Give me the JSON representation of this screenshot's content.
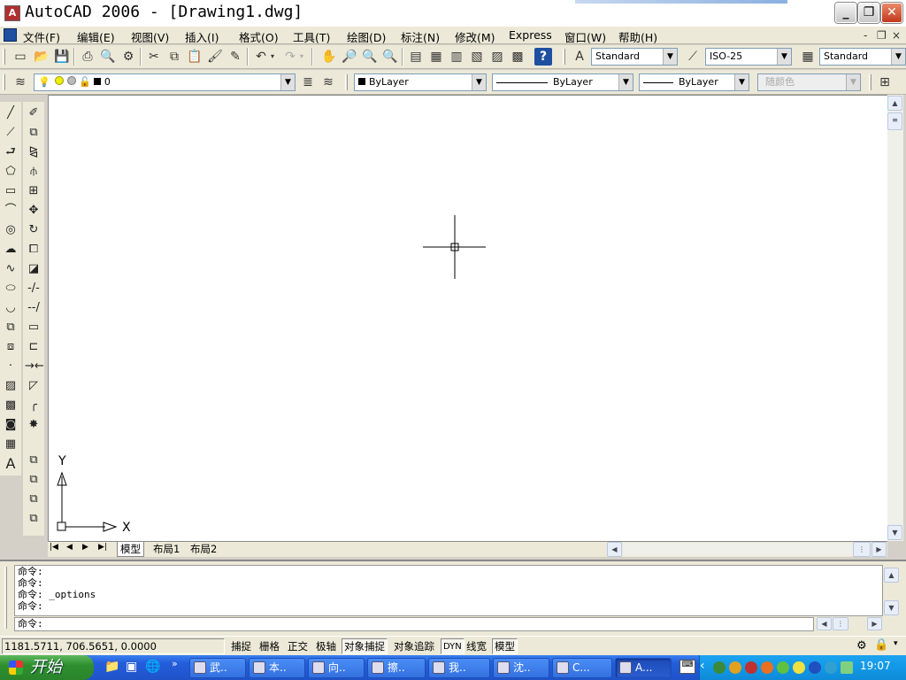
{
  "window": {
    "title": "AutoCAD 2006 - [Drawing1.dwg]",
    "app_icon": "autocad-icon",
    "buttons": [
      "minimize",
      "restore",
      "close"
    ]
  },
  "menu": {
    "items": [
      "文件(F)",
      "编辑(E)",
      "视图(V)",
      "插入(I)",
      "格式(O)",
      "工具(T)",
      "绘图(D)",
      "标注(N)",
      "修改(M)",
      "Express",
      "窗口(W)",
      "帮助(H)"
    ],
    "mdi_buttons": [
      "-",
      "❐",
      "×"
    ]
  },
  "standard_toolbar": {
    "text_style": "Standard",
    "dim_style": "ISO-25",
    "table_style": "Standard"
  },
  "layers_toolbar": {
    "current_layer": "0",
    "color": "ByLayer",
    "linetype": "ByLayer",
    "lineweight": "ByLayer",
    "plot_style": "随颜色"
  },
  "canvas": {
    "ucs_x_label": "X",
    "ucs_y_label": "Y",
    "background": "#ffffff"
  },
  "layout_tabs": [
    "模型",
    "布局1",
    "布局2"
  ],
  "command": {
    "history": [
      "命令:",
      "命令:",
      "命令: _options",
      "命令:"
    ],
    "prompt": "命令:"
  },
  "status": {
    "coordinates": "1181.5711,  706.5651,  0.0000",
    "toggles": [
      "捕捉",
      "栅格",
      "正交",
      "极轴",
      "对象捕捉",
      "对象追踪",
      "DYN",
      "线宽",
      "模型"
    ]
  },
  "taskbar": {
    "start_label": "开始",
    "tasks": [
      "武..",
      "本..",
      "向..",
      "擦..",
      "我..",
      "沈..",
      "C...",
      "A..."
    ],
    "clock": "19:07",
    "colors": {
      "taskbar": "#245edc",
      "start": "#2f8f2f",
      "tray": "#139be8"
    }
  }
}
